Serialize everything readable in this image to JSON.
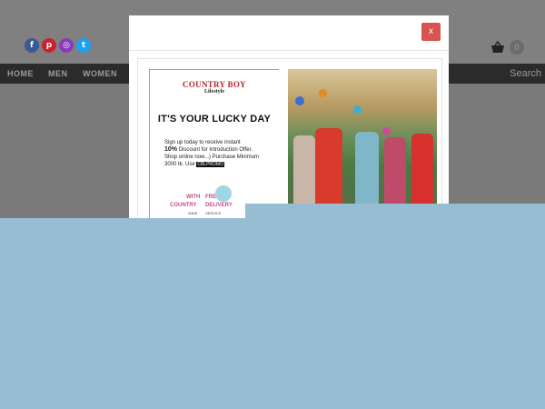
{
  "header": {
    "social": [
      {
        "name": "facebook",
        "glyph": "f",
        "color": "#3b5998"
      },
      {
        "name": "pinterest",
        "glyph": "p",
        "color": "#c8232c"
      },
      {
        "name": "instagram",
        "glyph": "◎",
        "color": "#8a3ab9"
      },
      {
        "name": "twitter",
        "glyph": "t",
        "color": "#1da1f2"
      }
    ],
    "cart_count": "0"
  },
  "nav": {
    "items": [
      "HOME",
      "MEN",
      "WOMEN"
    ],
    "search_label": "Search"
  },
  "modal": {
    "close_label": "x",
    "banner": {
      "brand": "COUNTRY BOY",
      "brand_sub": "Lifestyle",
      "headline": "IT'S YOUR LUCKY DAY",
      "promo_line1": "Sign up today to receive instant",
      "promo_pct": "10%",
      "promo_line2": "Discount for Introduction Offer.",
      "promo_line3": "Shop online now...) Purchase Minimum",
      "promo_line4": "3000 tk. Use",
      "promo_code": "CBLPROMO",
      "free_with": "WITH",
      "free_free": "FREE",
      "free_country": "COUNTRY",
      "free_delivery": "DELIVERY",
      "free_wide": "WIDE",
      "free_service": "SERVICE"
    }
  }
}
